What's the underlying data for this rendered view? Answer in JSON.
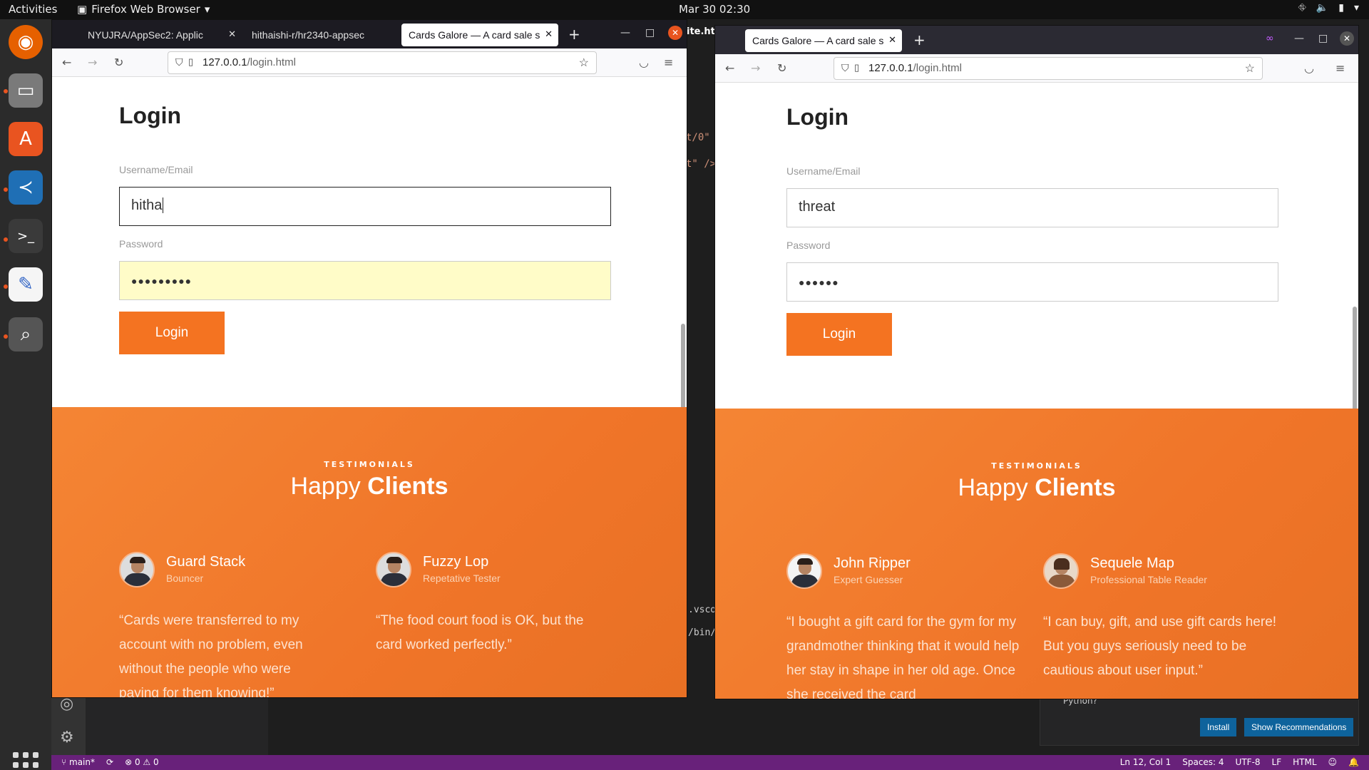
{
  "topbar": {
    "activities": "Activities",
    "app": "Firefox Web Browser",
    "clock": "Mar 30  02:30"
  },
  "dock": {
    "items": [
      "firefox-icon",
      "files-icon",
      "software-icon",
      "vscode-icon",
      "terminal-icon",
      "text-editor-icon",
      "search-icon"
    ]
  },
  "vscode": {
    "code_frags": [
      "t/0\"",
      "t\" />",
      "ite.ht",
      ".vsco",
      "/bin/"
    ],
    "notification": {
      "question": "Python?",
      "install": "Install",
      "show": "Show Recommendations"
    },
    "status": {
      "branch": "main*",
      "errors": "0",
      "warnings": "0",
      "position": "Ln 12, Col 1",
      "spaces": "Spaces: 4",
      "encoding": "UTF-8",
      "eol": "LF",
      "lang": "HTML"
    }
  },
  "left": {
    "tabs": [
      "NYUJRA/AppSec2: Applic",
      "hithaishi-r/hr2340-appsec",
      "Cards Galore — A card sale s"
    ],
    "url_host": "127.0.0.1",
    "url_path": "/login.html",
    "login_title": "Login",
    "username_label": "Username/Email",
    "username_value": "hitha",
    "password_label": "Password",
    "password_value": "●●●●●●●●●",
    "login_button": "Login",
    "eyebrow": "TESTIMONIALS",
    "happy": "Happy",
    "clients": "Clients",
    "testimonials": [
      {
        "name": "Guard Stack",
        "role": "Bouncer",
        "quote": "“Cards were transferred to my account with no problem, even without the people who were paying for them knowing!”"
      },
      {
        "name": "Fuzzy Lop",
        "role": "Repetative Tester",
        "quote": "“The food court food is OK, but the card worked perfectly.”"
      }
    ]
  },
  "right": {
    "tabs": [
      "Cards Galore — A card sale s"
    ],
    "url_host": "127.0.0.1",
    "url_path": "/login.html",
    "login_title": "Login",
    "username_label": "Username/Email",
    "username_value": "threat",
    "password_label": "Password",
    "password_value": "●●●●●●",
    "login_button": "Login",
    "eyebrow": "TESTIMONIALS",
    "happy": "Happy",
    "clients": "Clients",
    "testimonials": [
      {
        "name": "John Ripper",
        "role": "Expert Guesser",
        "quote": "“I bought a gift card for the gym for my grandmother thinking that it would help her stay in shape in her old age. Once she received the card"
      },
      {
        "name": "Sequele Map",
        "role": "Professional Table Reader",
        "quote": "“I can buy, gift, and use gift cards here! But you guys seriously need to be cautious about user input.”"
      }
    ]
  },
  "colors": {
    "accent": "#f47321",
    "status_bar": "#68217a",
    "autofill": "#fffcc8"
  }
}
